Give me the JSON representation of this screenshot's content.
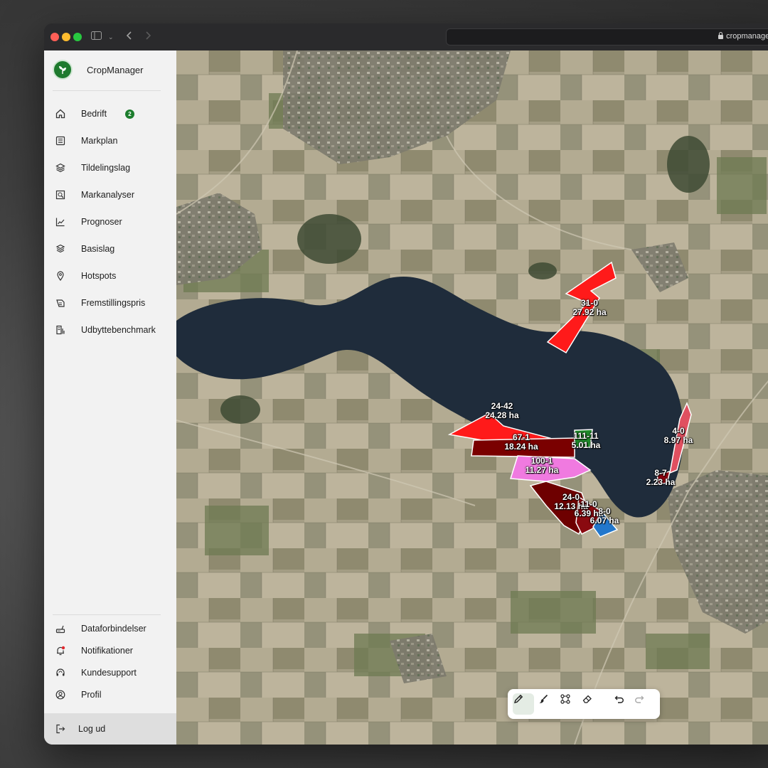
{
  "browser": {
    "url": "cropmanager.dk"
  },
  "brand": {
    "name": "CropManager"
  },
  "sidebar": {
    "items": [
      {
        "label": "Bedrift",
        "icon": "home-icon",
        "badge": "2"
      },
      {
        "label": "Markplan",
        "icon": "list-icon"
      },
      {
        "label": "Tildelingslag",
        "icon": "layers-icon"
      },
      {
        "label": "Markanalyser",
        "icon": "analysis-icon"
      },
      {
        "label": "Prognoser",
        "icon": "chart-icon"
      },
      {
        "label": "Basislag",
        "icon": "stack-icon"
      },
      {
        "label": "Hotspots",
        "icon": "pin-icon"
      },
      {
        "label": "Fremstillingspris",
        "icon": "price-icon"
      },
      {
        "label": "Udbyttebenchmark",
        "icon": "benchmark-icon"
      }
    ],
    "bottom_items": [
      {
        "label": "Dataforbindelser",
        "icon": "router-icon"
      },
      {
        "label": "Notifikationer",
        "icon": "bell-icon"
      },
      {
        "label": "Kundesupport",
        "icon": "headset-icon"
      },
      {
        "label": "Profil",
        "icon": "user-icon"
      }
    ],
    "logout": {
      "label": "Log ud",
      "icon": "logout-icon"
    }
  },
  "fields": [
    {
      "id": "31-0",
      "area": "27.92 ha",
      "color": "#ff1a1a"
    },
    {
      "id": "24-42",
      "area": "24.28 ha",
      "color": "#ff1a1a"
    },
    {
      "id": "67-1",
      "area": "18.24 ha",
      "color": "#7a0000"
    },
    {
      "id": "111-11",
      "area": "5.01 ha",
      "color": "#1f8a2a"
    },
    {
      "id": "100-1",
      "area": "11.27 ha",
      "color": "#f07ae0"
    },
    {
      "id": "24-0",
      "area": "12.13 ha",
      "color": "#6e0000"
    },
    {
      "id": "11-0",
      "area": "6.39 ha",
      "color": "#8a0a10"
    },
    {
      "id": "8-0",
      "area": "6.07 ha",
      "color": "#2277cc"
    },
    {
      "id": "4-0",
      "area": "8.97 ha",
      "color": "#e05060"
    },
    {
      "id": "8-7",
      "area": "2.23 ha",
      "color": "#8a0010"
    }
  ],
  "toolbar": {
    "tools": [
      "pencil-icon",
      "brush-icon",
      "nodes-icon",
      "eraser-icon",
      "undo-icon",
      "redo-icon"
    ],
    "active": "pencil-icon"
  }
}
